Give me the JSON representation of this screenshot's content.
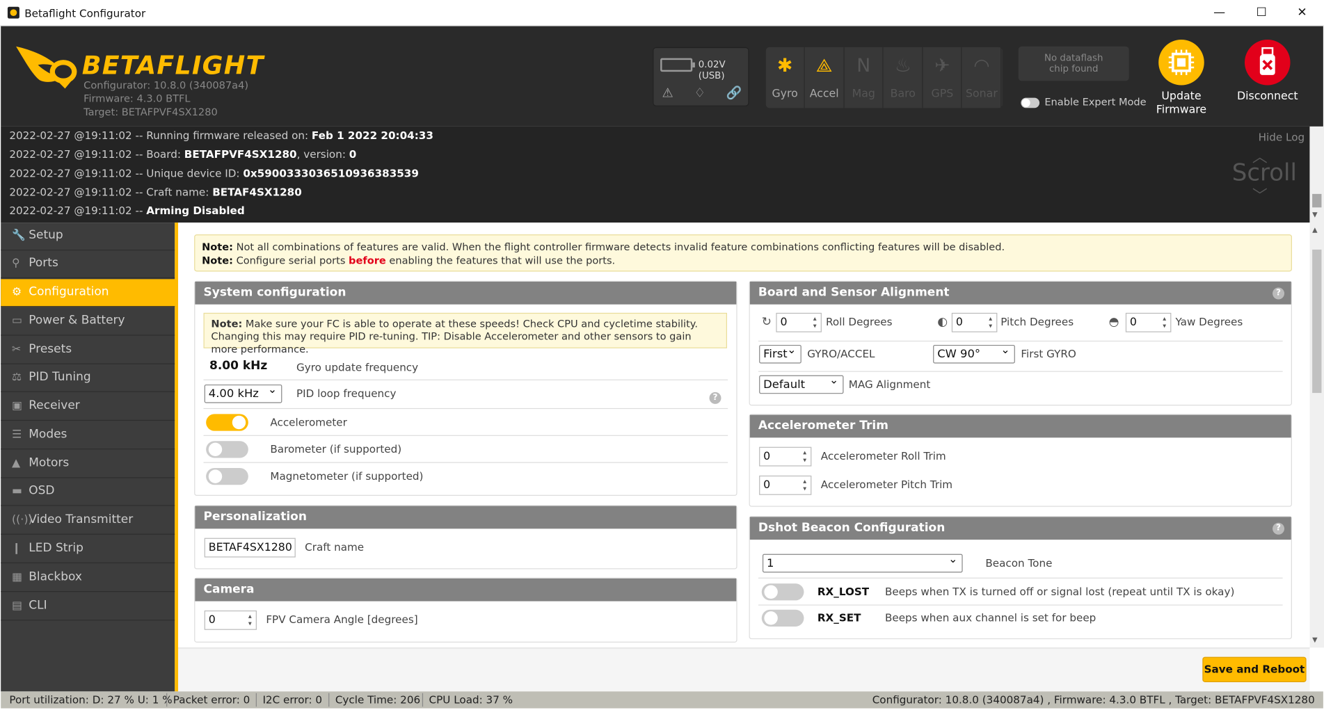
{
  "window": {
    "title": "Betaflight Configurator",
    "min": "—",
    "max": "☐",
    "close": "✕"
  },
  "header": {
    "logo_text": "BETAFLIGHT",
    "configurator_line": "Configurator: 10.8.0 (340087a4)",
    "firmware_line": "Firmware: 4.3.0 BTFL",
    "target_line": "Target: BETAFPVF4SX1280",
    "battery_voltage": "0.02V (USB)",
    "sensors": [
      {
        "label": "Gyro",
        "icon": "gyro-icon",
        "glyph": "✱",
        "state": "on"
      },
      {
        "label": "Accel",
        "icon": "accel-icon",
        "glyph": "⟁",
        "state": "on"
      },
      {
        "label": "Mag",
        "icon": "mag-icon",
        "glyph": "N",
        "state": "off"
      },
      {
        "label": "Baro",
        "icon": "baro-icon",
        "glyph": "♨",
        "state": "off"
      },
      {
        "label": "GPS",
        "icon": "gps-icon",
        "glyph": "✈",
        "state": "off"
      },
      {
        "label": "Sonar",
        "icon": "sonar-icon",
        "glyph": "◠",
        "state": "off"
      }
    ],
    "dataflash_line1": "No dataflash",
    "dataflash_line2": "chip found",
    "expert_mode_label": "Enable Expert Mode",
    "update_firmware_line1": "Update",
    "update_firmware_line2": "Firmware",
    "disconnect_label": "Disconnect"
  },
  "log": {
    "lines": [
      {
        "prefix": "2022-02-27 @19:11:02 -- Running firmware released on: ",
        "value": "Feb 1 2022 20:04:33"
      },
      {
        "prefix": "2022-02-27 @19:11:02 -- Board: ",
        "value": "BETAFPVF4SX1280",
        "suffix": ", version: ",
        "value2": "0"
      },
      {
        "prefix": "2022-02-27 @19:11:02 -- Unique device ID: ",
        "value": "0x590033303651093638353​9"
      },
      {
        "prefix": "2022-02-27 @19:11:02 -- Craft name: ",
        "value": "BETAF4SX1280"
      },
      {
        "prefix": "2022-02-27 @19:11:02 -- ",
        "value": "Arming Disabled"
      }
    ],
    "hide_log": "Hide Log",
    "scroll": "Scroll"
  },
  "nav": [
    {
      "label": "Setup",
      "glyph": "🔧",
      "icon": "wrench-icon"
    },
    {
      "label": "Ports",
      "glyph": "⚲",
      "icon": "plug-icon"
    },
    {
      "label": "Configuration",
      "glyph": "⚙",
      "icon": "gear-icon"
    },
    {
      "label": "Power & Battery",
      "glyph": "▭",
      "icon": "battery-icon"
    },
    {
      "label": "Presets",
      "glyph": "✂",
      "icon": "presets-icon"
    },
    {
      "label": "PID Tuning",
      "glyph": "⚖",
      "icon": "pid-icon"
    },
    {
      "label": "Receiver",
      "glyph": "▣",
      "icon": "receiver-icon"
    },
    {
      "label": "Modes",
      "glyph": "☰",
      "icon": "modes-icon"
    },
    {
      "label": "Motors",
      "glyph": "▲",
      "icon": "motors-icon"
    },
    {
      "label": "OSD",
      "glyph": "▬",
      "icon": "osd-icon"
    },
    {
      "label": "Video Transmitter",
      "glyph": "((·))",
      "icon": "vtx-icon"
    },
    {
      "label": "LED Strip",
      "glyph": "❙",
      "icon": "led-icon"
    },
    {
      "label": "Blackbox",
      "glyph": "▦",
      "icon": "blackbox-icon"
    },
    {
      "label": "CLI",
      "glyph": "▤",
      "icon": "cli-icon"
    }
  ],
  "note": {
    "line1_bold": "Note:",
    "line1": " Not all combinations of features are valid. When the flight controller firmware detects invalid feature combinations conflicting features will be disabled.",
    "line2_bold": "Note:",
    "line2_a": " Configure serial ports ",
    "line2_red": "before",
    "line2_b": " enabling the features that will use the ports."
  },
  "system": {
    "title": "System configuration",
    "note_bold": "Note:",
    "note_text": " Make sure your FC is able to operate at these speeds! Check CPU and cycletime stability. Changing this may require PID re-tuning. TIP: Disable Accelerometer and other sensors to gain more performance.",
    "gyro_freq_value": "8.00 kHz",
    "gyro_freq_label": "Gyro update frequency",
    "pid_freq_value": "4.00 kHz",
    "pid_freq_label": "PID loop frequency",
    "accelerometer": "Accelerometer",
    "barometer": "Barometer (if supported)",
    "magnetometer": "Magnetometer (if supported)",
    "accel_on": true,
    "baro_on": false,
    "mag_on": false
  },
  "personalization": {
    "title": "Personalization",
    "craft_name_value": "BETAF4SX1280",
    "craft_name_label": "Craft name"
  },
  "camera": {
    "title": "Camera",
    "angle_value": "0",
    "angle_label": "FPV Camera Angle [degrees]"
  },
  "alignment": {
    "title": "Board and Sensor Alignment",
    "roll_value": "0",
    "roll_label": "Roll Degrees",
    "pitch_value": "0",
    "pitch_label": "Pitch Degrees",
    "yaw_value": "0",
    "yaw_label": "Yaw Degrees",
    "gyro_sel": "First",
    "gyro_label": "GYRO/ACCEL",
    "gyro_align": "CW 90°",
    "gyro_align_label": "First GYRO",
    "mag_sel": "Default",
    "mag_label": "MAG Alignment"
  },
  "accel_trim": {
    "title": "Accelerometer Trim",
    "roll_value": "0",
    "roll_label": "Accelerometer Roll Trim",
    "pitch_value": "0",
    "pitch_label": "Accelerometer Pitch Trim"
  },
  "dshot": {
    "title": "Dshot Beacon Configuration",
    "tone_value": "1",
    "tone_label": "Beacon Tone",
    "rx_lost": "RX_LOST",
    "rx_lost_desc": "Beeps when TX is turned off or signal lost (repeat until TX is okay)",
    "rx_set": "RX_SET",
    "rx_set_desc": "Beeps when aux channel is set for beep"
  },
  "footer": {
    "save_reboot": "Save and Reboot"
  },
  "status": {
    "port_util": "Port utilization: D: 27 % U: 1 %",
    "packet_error": "Packet error: 0",
    "i2c_error": "I2C error: 0",
    "cycle_time": "Cycle Time: 206",
    "cpu_load": "CPU Load: 37 %",
    "version": "Configurator: 10.8.0 (340087a4) , Firmware: 4.3.0 BTFL , Target: BETAFPVF4SX1280"
  },
  "colors": {
    "accent": "#ffbb00",
    "header_bg": "#2a2a2a",
    "sidebar_bg": "#3d3d3d",
    "disconnect": "#e2001a"
  }
}
